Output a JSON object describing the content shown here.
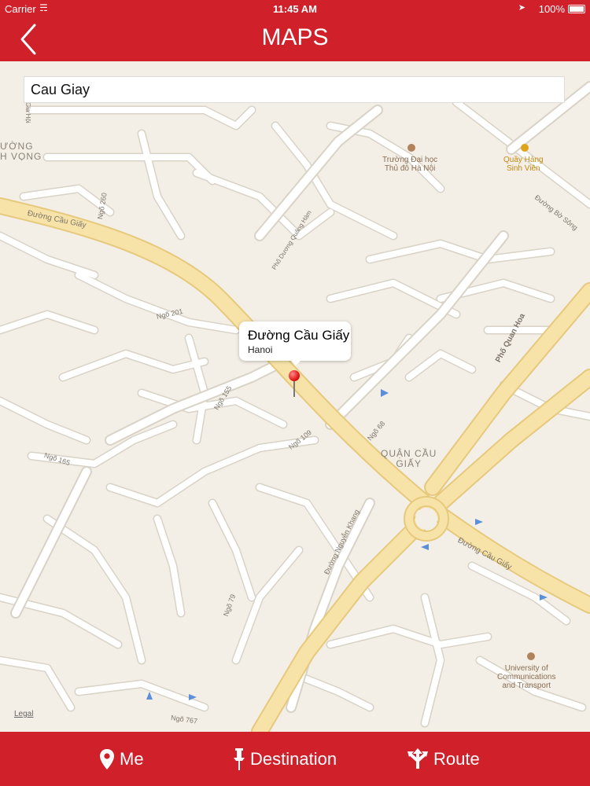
{
  "status_bar": {
    "carrier": "Carrier",
    "time": "11:45 AM",
    "battery": "100%"
  },
  "nav": {
    "title": "MAPS",
    "back_icon": "chevron-left-icon"
  },
  "search": {
    "value": "Cau Giay"
  },
  "callout": {
    "title": "Đường Cầu Giấy",
    "subtitle": "Hanoi"
  },
  "map": {
    "district_labels": [
      "QUẬN CẦU",
      "GIẤY"
    ],
    "area_label_left": [
      "ƯỜNG",
      "H VỌNG"
    ],
    "pois": [
      {
        "name": [
          "Trường Đại học",
          "Thủ đô Hà Nội"
        ],
        "icon": "university-icon",
        "color": "#b0835a"
      },
      {
        "name": [
          "Quầy Hàng",
          "Sinh Viên"
        ],
        "icon": "shop-icon",
        "color": "#e0a31c"
      },
      {
        "name": [
          "University of",
          "Communications",
          "and Transport"
        ],
        "icon": "university-icon",
        "color": "#b0835a"
      }
    ],
    "road_labels": [
      "Đường Cầu Giấy",
      "Đường Cầu Giấy",
      "Phố Dương Quảng Hàm",
      "Phố Quan Hoa",
      "Đường Bờ Sông",
      "Ngõ 260",
      "Ngõ 201",
      "Ngõ 155",
      "Ngõ 109",
      "Ngõ 68",
      "Ngõ 165",
      "Ngõ 79",
      "Ngõ 767",
      "Đường Nguyễn Khang",
      "Gia Hội"
    ],
    "legal": "Legal",
    "colors": {
      "land": "#f3eee6",
      "major_road": "#f7e3a8",
      "major_road_edge": "#e6c97c",
      "minor_road": "#ffffff",
      "minor_road_edge": "#d9d2c6"
    }
  },
  "tabs": [
    {
      "label": "Me",
      "icon": "location-pin-icon"
    },
    {
      "label": "Destination",
      "icon": "push-pin-icon"
    },
    {
      "label": "Route",
      "icon": "route-icon"
    }
  ],
  "accent_color": "#d0202a"
}
